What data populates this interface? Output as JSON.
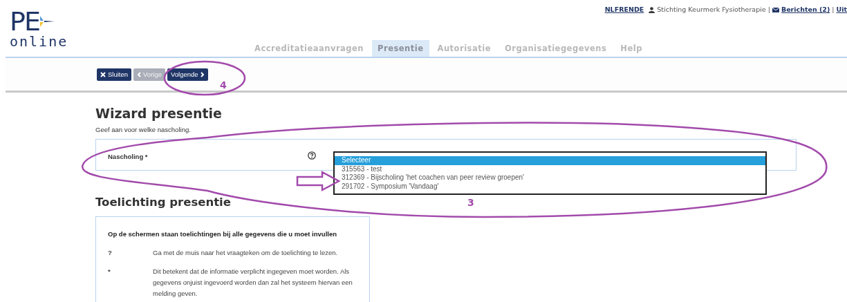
{
  "header": {
    "logo": {
      "top": "PE",
      "bottom": "online"
    },
    "user_code": "NLFRENDE",
    "organisation": "Stichting Keurmerk Fysiotherapie",
    "separator_1": "|",
    "messages": "Berichten (2)",
    "separator_2": "|",
    "logout": "Uit"
  },
  "tabs": [
    {
      "label": "Accreditatieaanvragen",
      "selected": false
    },
    {
      "label": "Presentie",
      "selected": true
    },
    {
      "label": "Autorisatie",
      "selected": false
    },
    {
      "label": "Organisatiegegevens",
      "selected": false
    },
    {
      "label": "Help",
      "selected": false
    }
  ],
  "toolbar": [
    {
      "label": "Sluiten",
      "kind": "close",
      "disabled": false
    },
    {
      "label": "Vorige",
      "kind": "previous",
      "disabled": true
    },
    {
      "label": "Volgende",
      "kind": "next",
      "disabled": false
    }
  ],
  "title": "Wizard presentie",
  "intro": "Geef aan voor welke nascholing.",
  "field": {
    "label": "Nascholing *",
    "options": [
      {
        "label": "Selecteer",
        "selected": true
      },
      {
        "label": "315563 - test",
        "selected": false
      },
      {
        "label": "312369 - Bijscholing 'het coachen van peer review groepen'",
        "selected": false
      },
      {
        "label": "291702 - Symposium 'Vandaag'",
        "selected": false
      }
    ]
  },
  "explanation": {
    "title": "Toelichting presentie",
    "heading": "Op de schermen staan toelichtingen bij alle gegevens die u moet invullen",
    "rows": [
      {
        "symbol": "?",
        "text": "Ga met de muis naar het vraagteken om de toelichting te lezen."
      },
      {
        "symbol": "*",
        "text": "Dit betekent dat de informatie verplicht ingegeven moet worden. Als gegevens onjuist ingevoerd worden dan zal het systeem hiervan een melding geven."
      }
    ]
  },
  "annotations": [
    {
      "label": "4"
    },
    {
      "label": "3"
    }
  ]
}
